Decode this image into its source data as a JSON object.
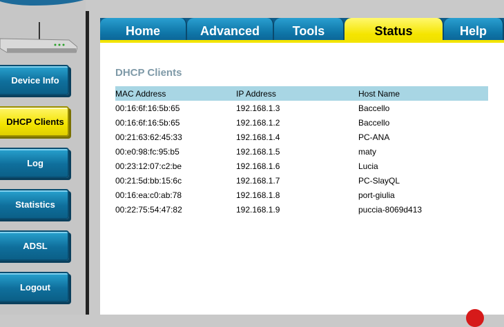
{
  "sidebar": {
    "items": [
      {
        "label": "Device Info"
      },
      {
        "label": "DHCP Clients"
      },
      {
        "label": "Log"
      },
      {
        "label": "Statistics"
      },
      {
        "label": "ADSL"
      },
      {
        "label": "Logout"
      }
    ],
    "active": "DHCP Clients"
  },
  "tabs": [
    {
      "label": "Home"
    },
    {
      "label": "Advanced"
    },
    {
      "label": "Tools"
    },
    {
      "label": "Status"
    },
    {
      "label": "Help"
    }
  ],
  "active_tab": "Status",
  "main": {
    "title": "DHCP Clients",
    "columns": [
      "MAC Address",
      "IP Address",
      "Host Name"
    ],
    "rows": [
      {
        "mac": "00:16:6f:16:5b:65",
        "ip": "192.168.1.3",
        "host": "Baccello"
      },
      {
        "mac": "00:16:6f:16:5b:65",
        "ip": "192.168.1.2",
        "host": "Baccello"
      },
      {
        "mac": "00:21:63:62:45:33",
        "ip": "192.168.1.4",
        "host": "PC-ANA"
      },
      {
        "mac": "00:e0:98:fc:95:b5",
        "ip": "192.168.1.5",
        "host": "maty"
      },
      {
        "mac": "00:23:12:07:c2:be",
        "ip": "192.168.1.6",
        "host": "Lucia"
      },
      {
        "mac": "00:21:5d:bb:15:6c",
        "ip": "192.168.1.7",
        "host": "PC-SlayQL"
      },
      {
        "mac": "00:16:ea:c0:ab:78",
        "ip": "192.168.1.8",
        "host": "port-giulia"
      },
      {
        "mac": "00:22:75:54:47:82",
        "ip": "192.168.1.9",
        "host": "puccia-8069d413"
      }
    ]
  },
  "colors": {
    "tab_blue": "#1078aa",
    "active_yellow": "#f3e400",
    "header_row": "#a8d6e4",
    "title_gray": "#7f9aa8"
  }
}
